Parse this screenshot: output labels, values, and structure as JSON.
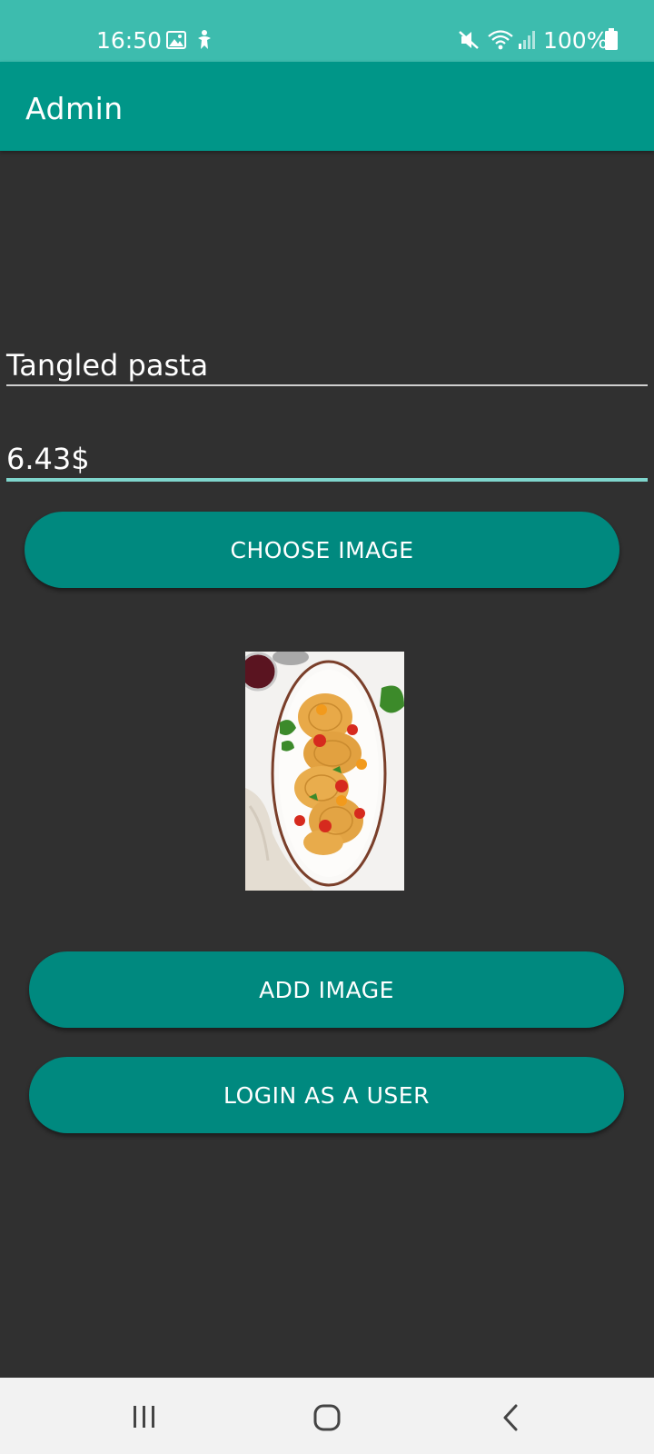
{
  "status_bar": {
    "time": "16:50",
    "battery": "100%",
    "icons": [
      "image-icon",
      "accessibility-icon",
      "mute-icon",
      "wifi-icon",
      "signal-icon",
      "battery-icon"
    ]
  },
  "app_bar": {
    "title": "Admin"
  },
  "form": {
    "name_value": "Tangled pasta",
    "price_value": "6.43$",
    "choose_image_label": "CHOOSE IMAGE",
    "preview_image": "pasta-plate-image",
    "add_image_label": "ADD IMAGE",
    "login_user_label": "LOGIN AS A USER"
  },
  "nav_bar": {
    "icons": [
      "recent-apps-icon",
      "home-icon",
      "back-icon"
    ]
  },
  "colors": {
    "status_bar": "#3dbcae",
    "app_bar": "#009688",
    "background": "#303030",
    "button": "#00897f",
    "field_focus_line": "#7fd6cd",
    "nav_bar": "#f2f2f2"
  }
}
